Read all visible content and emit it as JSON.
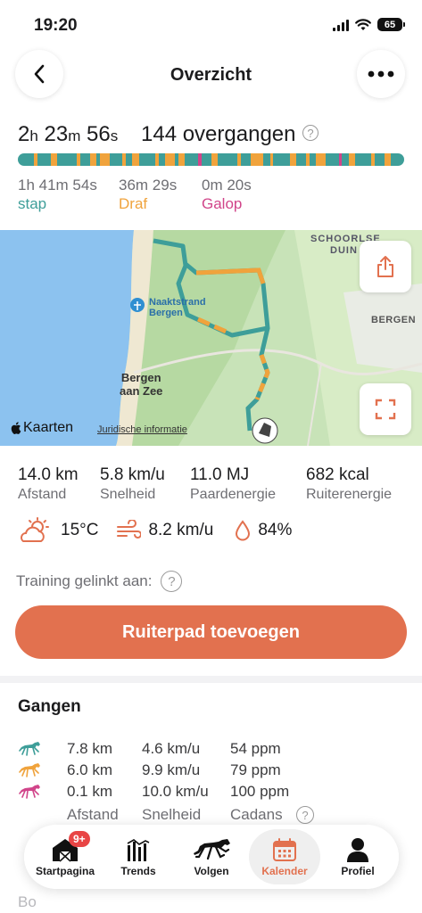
{
  "status": {
    "time": "19:20",
    "battery": "65"
  },
  "header": {
    "title": "Overzicht",
    "back_icon": "chevron-left-icon",
    "more_icon": "ellipsis-icon"
  },
  "summary": {
    "duration": {
      "h": "2",
      "h_unit": "h",
      "m": "23",
      "m_unit": "m",
      "s": "56",
      "s_unit": "s"
    },
    "transitions": "144 overgangen",
    "help": "?"
  },
  "gait_breakdown": [
    {
      "time": "1h 41m 54s",
      "label": "stap",
      "color": "#3e9e99"
    },
    {
      "time": "36m 29s",
      "label": "Draf",
      "color": "#f0a33c"
    },
    {
      "time": "0m 20s",
      "label": "Galop",
      "color": "#d1458a"
    }
  ],
  "map": {
    "labels": {
      "beach": "Naaktstrand Bergen",
      "beach_l1": "Naaktstrand",
      "beach_l2": "Bergen",
      "bergen_aan_zee_l1": "Bergen",
      "bergen_aan_zee_l2": "aan Zee",
      "bergen": "BERGEN",
      "schoorlse_l1": "SCHOORLSE",
      "schoorlse_l2": "DUIN"
    },
    "attribution": "Kaarten",
    "legal": "Juridische informatie",
    "share_icon": "share-icon",
    "expand_icon": "expand-icon"
  },
  "stats": [
    {
      "value": "14.0 km",
      "label": "Afstand"
    },
    {
      "value": "5.8 km/u",
      "label": "Snelheid"
    },
    {
      "value": "11.0 MJ",
      "label": "Paardenergie"
    },
    {
      "value": "682 kcal",
      "label": "Ruiterenergie"
    }
  ],
  "weather": {
    "temperature": "15°C",
    "wind": "8.2 km/u",
    "humidity": "84%"
  },
  "training_link": {
    "label": "Training gelinkt aan:",
    "help": "?"
  },
  "cta": {
    "label": "Ruiterpad toevoegen"
  },
  "gaits": {
    "title": "Gangen",
    "rows": [
      {
        "distance": "7.8 km",
        "speed": "4.6 km/u",
        "cadence": "54 ppm",
        "color": "#3e9e99"
      },
      {
        "distance": "6.0 km",
        "speed": "9.9 km/u",
        "cadence": "79 ppm",
        "color": "#f0a33c"
      },
      {
        "distance": "0.1 km",
        "speed": "10.0 km/u",
        "cadence": "100 ppm",
        "color": "#d1458a"
      }
    ],
    "headers": {
      "distance": "Afstand",
      "speed": "Snelheid",
      "cadence": "Cadans"
    }
  },
  "tabs": [
    {
      "label": "Startpagina",
      "badge": "9+"
    },
    {
      "label": "Trends"
    },
    {
      "label": "Volgen"
    },
    {
      "label": "Kalender",
      "active": true
    },
    {
      "label": "Profiel"
    }
  ],
  "peek_text": "Bo",
  "colors": {
    "accent": "#e2714f",
    "walk": "#3e9e99",
    "trot": "#f0a33c",
    "canter": "#d1458a"
  }
}
